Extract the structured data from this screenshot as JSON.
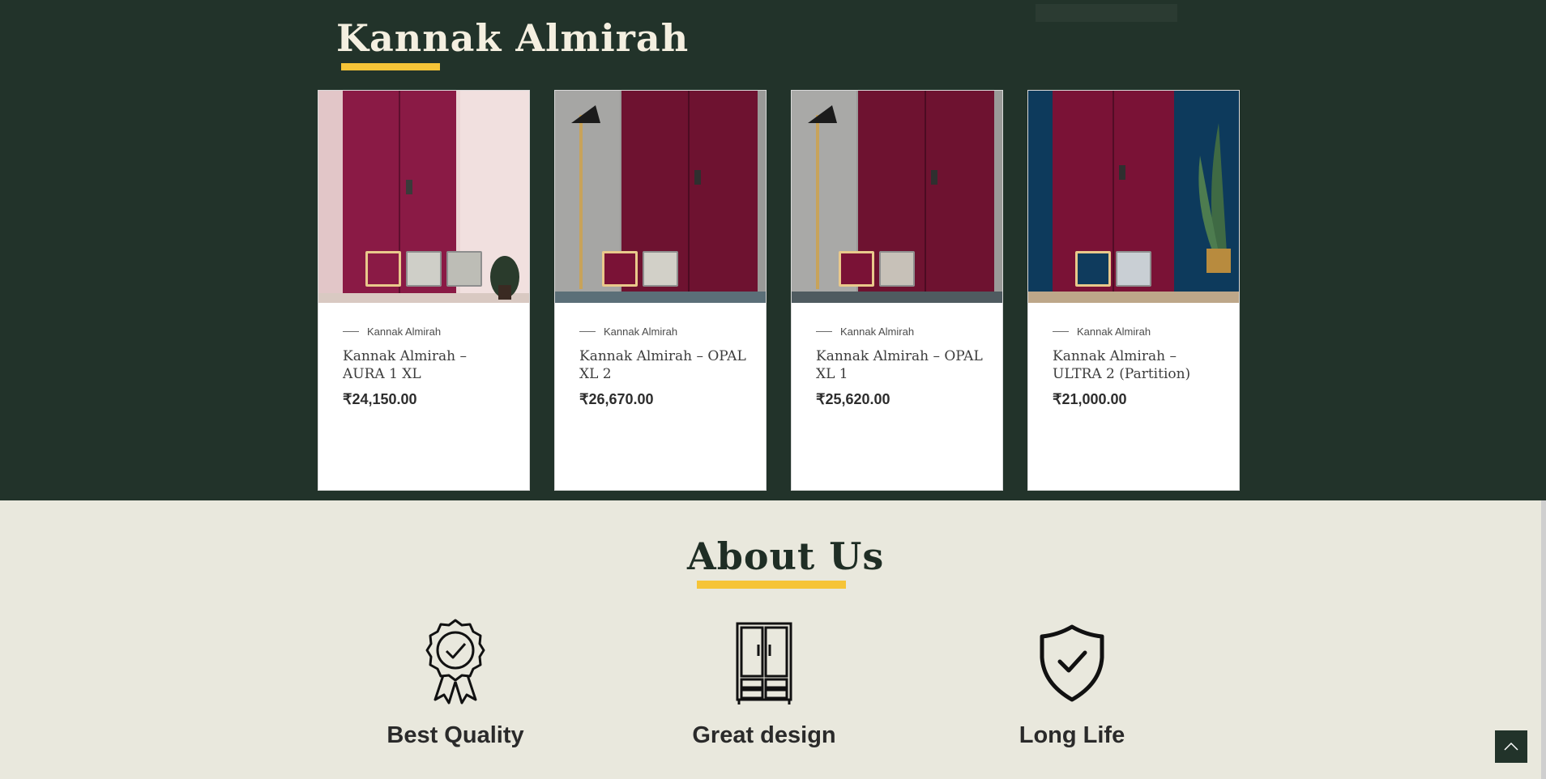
{
  "products_section": {
    "title": "Kannak Almirah",
    "products": [
      {
        "category": "Kannak Almirah",
        "name": "Kannak Almirah – AURA 1 XL",
        "price": "₹24,150.00"
      },
      {
        "category": "Kannak Almirah",
        "name": "Kannak Almirah – OPAL XL 2",
        "price": "₹26,670.00"
      },
      {
        "category": "Kannak Almirah",
        "name": "Kannak Almirah – OPAL XL 1",
        "price": "₹25,620.00"
      },
      {
        "category": "Kannak Almirah",
        "name": "Kannak Almirah – ULTRA 2 (Partition)",
        "price": "₹21,000.00"
      }
    ]
  },
  "about_section": {
    "title": "About Us",
    "features": [
      {
        "label": "Best Quality",
        "icon": "award-badge-icon"
      },
      {
        "label": "Great design",
        "icon": "wardrobe-icon"
      },
      {
        "label": "Long Life",
        "icon": "shield-check-icon"
      }
    ]
  },
  "colors": {
    "dark_green": "#22332a",
    "accent_yellow": "#f6c437",
    "cream": "#e9e8dd",
    "maroon": "#7a1236"
  },
  "scroll_top_icon": "chevron-up-icon"
}
